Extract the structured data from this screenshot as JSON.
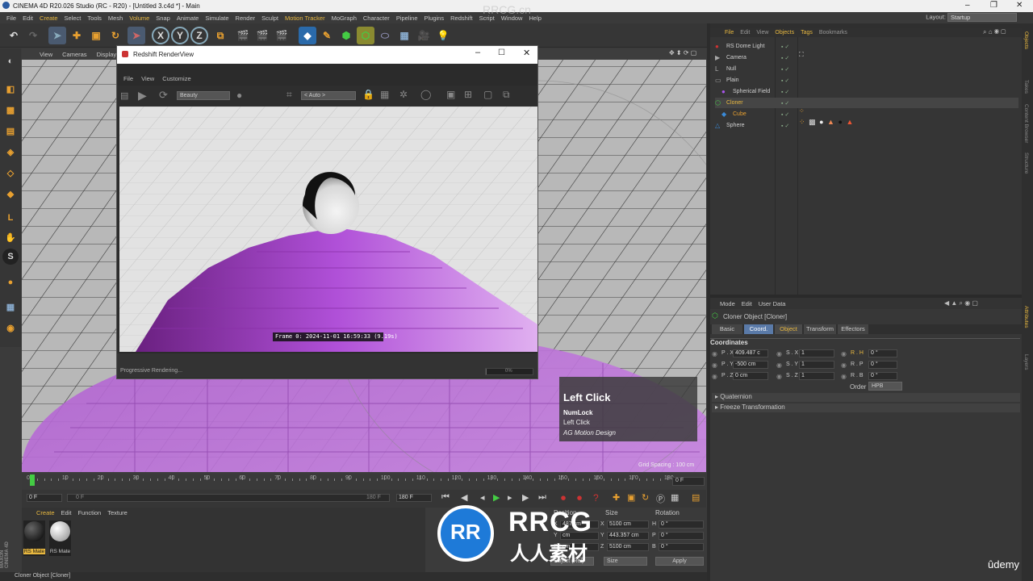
{
  "window": {
    "title": "CINEMA 4D R20.026 Studio (RC - R20) - [Untitled 3.c4d *] - Main"
  },
  "menubar": {
    "items": [
      "File",
      "Edit",
      "Create",
      "Select",
      "Tools",
      "Mesh",
      "Volume",
      "Snap",
      "Animate",
      "Simulate",
      "Render",
      "Sculpt",
      "Motion Tracker",
      "MoGraph",
      "Character",
      "Pipeline",
      "Plugins",
      "Redshift",
      "Script",
      "Window",
      "Help"
    ],
    "layout_label": "Layout:",
    "layout_value": "Startup"
  },
  "viewport": {
    "menu": [
      "View",
      "Cameras",
      "Display"
    ],
    "grid_spacing": "Grid Spacing : 100 cm"
  },
  "renderview": {
    "title": "Redshift RenderView",
    "menu": [
      "File",
      "View",
      "Customize"
    ],
    "aov": "Beauty",
    "res": "< Auto >",
    "frame_info": "Frame 0: 2024-11-01  16:59:33  (9.19s)",
    "status": "Progressive Rendering...",
    "progress": "0%",
    "progress_value": 0.02
  },
  "timeline": {
    "ticks": [
      "0",
      "10",
      "20",
      "30",
      "40",
      "50",
      "60",
      "70",
      "80",
      "90",
      "100",
      "110",
      "120",
      "130",
      "140",
      "150",
      "160",
      "170",
      "180"
    ],
    "frame_end_field": "0 F"
  },
  "playbar": {
    "start": "0 F",
    "range_start": "0 F",
    "range_end": "180 F",
    "end": "180 F"
  },
  "materials": {
    "menu": [
      "Create",
      "Edit",
      "Function",
      "Texture"
    ],
    "items": [
      "RS Mate",
      "RS Mate"
    ]
  },
  "coords": {
    "headers": [
      "Position",
      "Size",
      "Rotation"
    ],
    "rows": [
      {
        "axis": "X",
        "pos": "487 cm",
        "size": "5100 cm",
        "rlabel": "H",
        "rot": "0 °"
      },
      {
        "axis": "Y",
        "pos": "cm",
        "size": "443.357 cm",
        "rlabel": "P",
        "rot": "0 °"
      },
      {
        "axis": "Z",
        "pos": "cm",
        "size": "5100 cm",
        "rlabel": "B",
        "rot": "0 °"
      }
    ],
    "mode": "Object (Rel)",
    "size_mode": "Size",
    "apply": "Apply"
  },
  "status": {
    "text": "Cloner Object [Cloner]"
  },
  "objmgr": {
    "menu": [
      "File",
      "Edit",
      "View",
      "Objects",
      "Tags",
      "Bookmarks"
    ],
    "objects": [
      {
        "name": "RS Dome Light",
        "color": "#d0d0d0",
        "icon": "dome-light-icon"
      },
      {
        "name": "Camera",
        "color": "#d0d0d0",
        "icon": "camera-icon"
      },
      {
        "name": "Null",
        "color": "#d0d0d0",
        "icon": "null-icon"
      },
      {
        "name": "Plain",
        "color": "#d0d0d0",
        "icon": "plain-icon"
      },
      {
        "name": "Spherical Field",
        "color": "#d0d0d0",
        "icon": "field-icon"
      },
      {
        "name": "Cloner",
        "color": "#e8b840",
        "icon": "cloner-icon"
      },
      {
        "name": "Cube",
        "color": "#e8a030",
        "icon": "cube-icon"
      },
      {
        "name": "Sphere",
        "color": "#d0d0d0",
        "icon": "sphere-icon"
      }
    ]
  },
  "attr": {
    "menu": [
      "Mode",
      "Edit",
      "User Data"
    ],
    "title": "Cloner Object [Cloner]",
    "tabs": [
      "Basic",
      "Coord.",
      "Object",
      "Transform",
      "Effectors"
    ],
    "section": "Coordinates",
    "rows": [
      {
        "p": "P . X",
        "pv": "409.487 c",
        "s": "S . X",
        "sv": "1",
        "r": "R . H",
        "rv": "0 °"
      },
      {
        "p": "P . Y",
        "pv": "-500 cm",
        "s": "S . Y",
        "sv": "1",
        "r": "R . P",
        "rv": "0 °"
      },
      {
        "p": "P . Z",
        "pv": "0 cm",
        "s": "S . Z",
        "sv": "1",
        "r": "R . B",
        "rv": "0 °"
      }
    ],
    "order_label": "Order",
    "order": "HPB",
    "groups": [
      "Quaternion",
      "Freeze Transformation"
    ]
  },
  "overlay": {
    "title": "Left Click",
    "line1": "NumLock",
    "line2": "Left Click",
    "line3": "AG Motion Design"
  },
  "watermark": {
    "brand": "RRCG",
    "sub": "人人素材",
    "udemy": "ûdemy",
    "top": "RRCG.cn"
  },
  "side_tabs": [
    "Objects",
    "Takes",
    "Content Browser",
    "Structure",
    "Attributes",
    "Layers"
  ],
  "colors": {
    "accent": "#e8b840",
    "highlight_tab": "#5a7aa8"
  }
}
